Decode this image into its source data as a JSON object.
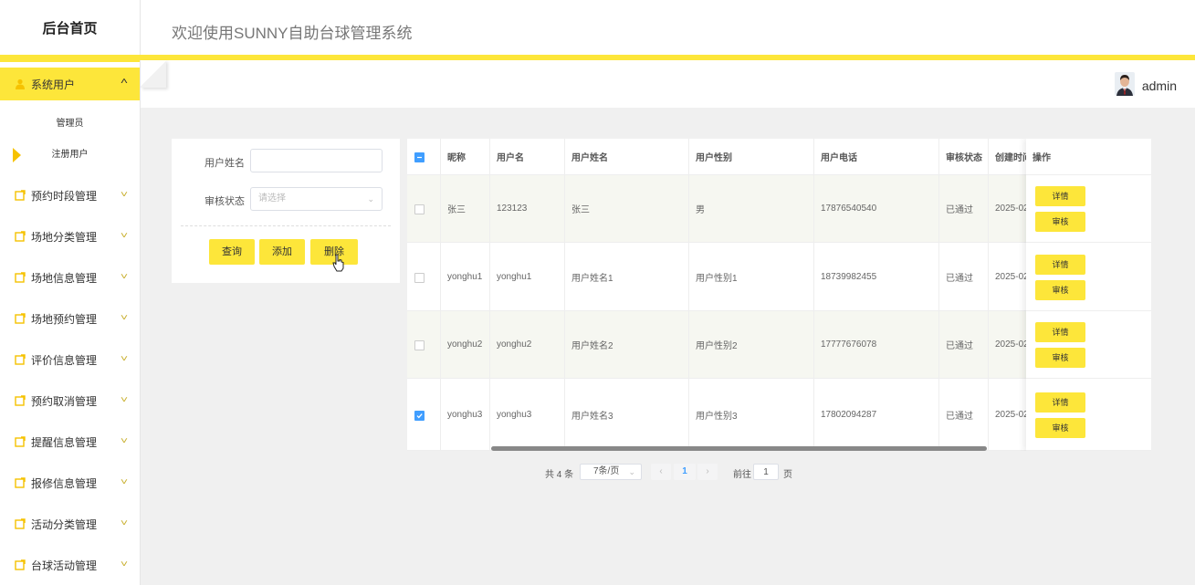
{
  "sidebar": {
    "brand": "后台首页",
    "menu": [
      {
        "label": "系统用户",
        "icon": "user-icon"
      },
      {
        "label": "预约时段管理",
        "icon": "note-icon"
      },
      {
        "label": "场地分类管理",
        "icon": "note-icon"
      },
      {
        "label": "场地信息管理",
        "icon": "note-icon"
      },
      {
        "label": "场地预约管理",
        "icon": "note-icon"
      },
      {
        "label": "评价信息管理",
        "icon": "note-icon"
      },
      {
        "label": "预约取消管理",
        "icon": "note-icon"
      },
      {
        "label": "提醒信息管理",
        "icon": "note-icon"
      },
      {
        "label": "报修信息管理",
        "icon": "note-icon"
      },
      {
        "label": "活动分类管理",
        "icon": "note-icon"
      },
      {
        "label": "台球活动管理",
        "icon": "note-icon"
      }
    ],
    "submenu": [
      "管理员",
      "注册用户"
    ]
  },
  "header": {
    "title": "欢迎使用SUNNY自助台球管理系统",
    "user": "admin"
  },
  "search": {
    "name_label": "用户姓名",
    "name_value": "",
    "status_label": "审核状态",
    "status_placeholder": "请选择",
    "query_label": "查询",
    "add_label": "添加",
    "delete_label": "删除"
  },
  "table": {
    "columns": [
      "昵称",
      "用户名",
      "用户姓名",
      "用户性别",
      "用户电话",
      "审核状态",
      "创建时间",
      "操作"
    ],
    "rows": [
      {
        "checked": false,
        "nickname": "张三",
        "username": "123123",
        "realname": "张三",
        "gender": "男",
        "phone": "17876540540",
        "status": "已通过",
        "created": "2025-02"
      },
      {
        "checked": false,
        "nickname": "yonghu1",
        "username": "yonghu1",
        "realname": "用户姓名1",
        "gender": "用户性别1",
        "phone": "18739982455",
        "status": "已通过",
        "created": "2025-02"
      },
      {
        "checked": false,
        "nickname": "yonghu2",
        "username": "yonghu2",
        "realname": "用户姓名2",
        "gender": "用户性别2",
        "phone": "17777676078",
        "status": "已通过",
        "created": "2025-02"
      },
      {
        "checked": true,
        "nickname": "yonghu3",
        "username": "yonghu3",
        "realname": "用户姓名3",
        "gender": "用户性别3",
        "phone": "17802094287",
        "status": "已通过",
        "created": "2025-02"
      }
    ],
    "detail_label": "详情",
    "audit_label": "审核"
  },
  "pagination": {
    "total": "共 4 条",
    "page_size": "7条/页",
    "current_page": "1",
    "goto_label": "前往",
    "goto_value": "1",
    "page_unit": "页"
  },
  "colors": {
    "accent": "#fde63a",
    "checkbox": "#409eff"
  }
}
